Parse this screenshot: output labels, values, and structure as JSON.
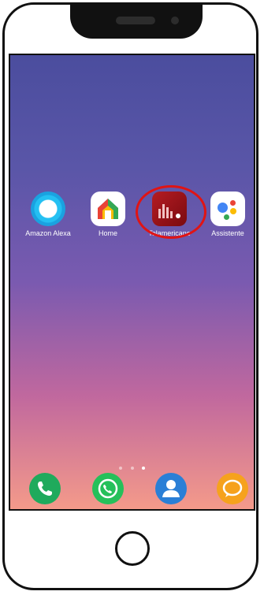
{
  "home_screen": {
    "apps": [
      {
        "label": "Amazon Alexa",
        "icon": "amazon-alexa-icon"
      },
      {
        "label": "Home",
        "icon": "google-home-icon"
      },
      {
        "label": "Telamericano",
        "icon": "telamericano-icon",
        "highlighted": true
      },
      {
        "label": "Assistente",
        "icon": "google-assistant-icon"
      }
    ],
    "pager": {
      "pages": 3,
      "current": 3
    }
  },
  "dock": {
    "apps": [
      {
        "icon": "phone-icon",
        "color": "#1faa5c"
      },
      {
        "icon": "whatsapp-icon",
        "color": "#25c05a"
      },
      {
        "icon": "contacts-icon",
        "color": "#2a7fd6"
      },
      {
        "icon": "messages-icon",
        "color": "#f6a21d"
      }
    ]
  },
  "colors": {
    "highlight_circle": "#e01414",
    "wallpaper_top": "#4b4d9e",
    "wallpaper_bottom": "#f49a8a"
  }
}
